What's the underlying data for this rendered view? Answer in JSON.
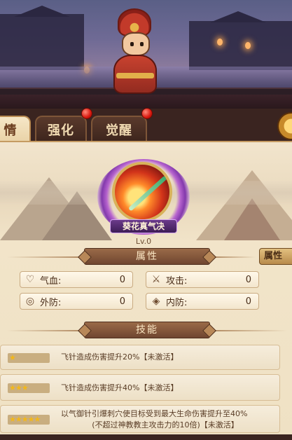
{
  "tabs": [
    {
      "label": "情",
      "active": true
    },
    {
      "label": "强化",
      "active": false,
      "badge": true
    },
    {
      "label": "觉醒",
      "active": false,
      "badge": true
    }
  ],
  "skill": {
    "name": "葵花真气决",
    "level": "Lv.0"
  },
  "attributes_section": {
    "title": "属性",
    "side_tag": "属性",
    "items": [
      {
        "icon": "heart-icon",
        "label": "气血:",
        "value": "0"
      },
      {
        "icon": "sword-icon",
        "label": "攻击:",
        "value": "0"
      },
      {
        "icon": "shield-icon",
        "label": "外防:",
        "value": "0"
      },
      {
        "icon": "inner-shield-icon",
        "label": "内防:",
        "value": "0"
      }
    ]
  },
  "skills_section": {
    "title": "技能",
    "rows": [
      {
        "stars": 1,
        "star_text": "★",
        "text": "飞针造成伤害提升20%【未激活】"
      },
      {
        "stars": 3,
        "star_text": "★★★",
        "text": "飞针造成伤害提升40%【未激活】"
      },
      {
        "stars": 5,
        "star_text": "★★★★★",
        "line1": "以气御针引爆刺穴使目标受到最大生命伤害提升至40%",
        "line2": "(不超过神教教主攻击力的10倍)【未激活】"
      }
    ]
  },
  "colors": {
    "accent": "#6b3d1f",
    "panel": "#f3e6cc",
    "badge": "#d8180e"
  }
}
